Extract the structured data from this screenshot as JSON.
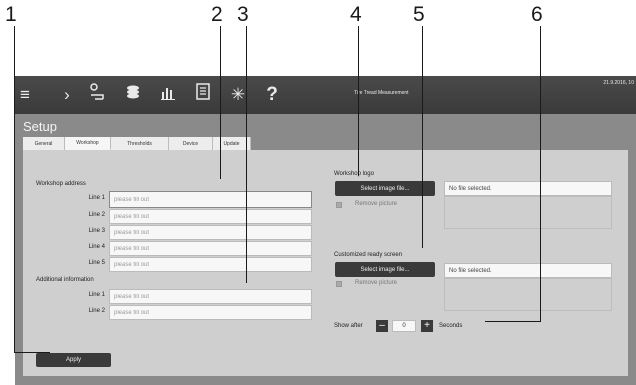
{
  "callouts": [
    "1",
    "2",
    "3",
    "4",
    "5",
    "6"
  ],
  "topbar": {
    "icons": [
      "hamburger-icon",
      "chevron-right-icon",
      "user-cart-icon",
      "layers-icon",
      "bar-chart-icon",
      "document-icon",
      "sun-icon",
      "help-icon"
    ],
    "help_label": "?",
    "title": "Tire Tread Measurement",
    "date": "21.9.2016, 10"
  },
  "page": {
    "title": "Setup"
  },
  "tabs": [
    {
      "label": "General"
    },
    {
      "label": "Workshop"
    },
    {
      "label": "Thresholds"
    },
    {
      "label": "Device"
    },
    {
      "label": "Update"
    }
  ],
  "workshop_address": {
    "heading": "Workshop address",
    "lines": [
      {
        "label": "Line 1",
        "placeholder": "please fill out"
      },
      {
        "label": "Line 2",
        "placeholder": "please fill out"
      },
      {
        "label": "Line 3",
        "placeholder": "please fill out"
      },
      {
        "label": "Line 4",
        "placeholder": "please fill out"
      },
      {
        "label": "Line 5",
        "placeholder": "please fill out"
      }
    ]
  },
  "additional_info": {
    "heading": "Additional information",
    "lines": [
      {
        "label": "Line 1",
        "placeholder": "please fill out"
      },
      {
        "label": "Line 2",
        "placeholder": "please fill out"
      }
    ]
  },
  "workshop_logo": {
    "heading": "Workshop logo",
    "select_label": "Select image file...",
    "file_status": "No file selected.",
    "remove_label": "Remove picture"
  },
  "ready_screen": {
    "heading": "Customized ready screen",
    "select_label": "Select image file...",
    "file_status": "No file selected.",
    "remove_label": "Remove picture"
  },
  "show_after": {
    "label": "Show after",
    "value": "0",
    "unit": "Seconds",
    "minus": "–",
    "plus": "+"
  },
  "apply_label": "Apply"
}
